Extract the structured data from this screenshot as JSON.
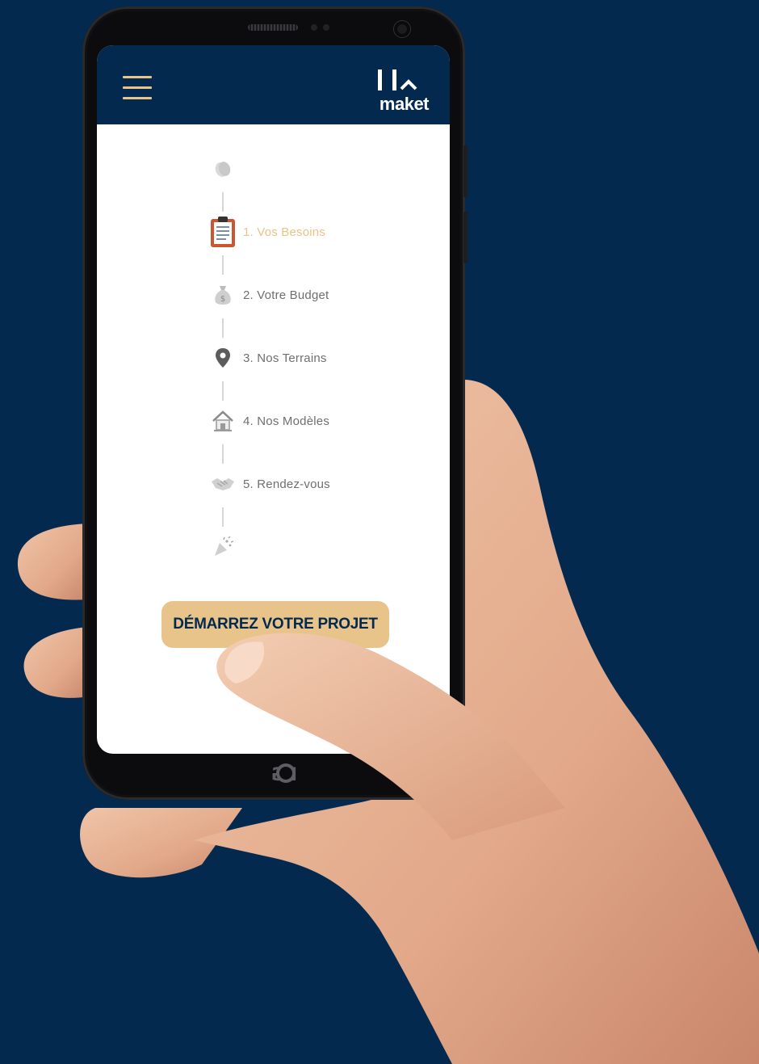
{
  "app": {
    "logo_text": "maket",
    "menu_icon": "hamburger-menu-icon"
  },
  "steps": [
    {
      "icon": "clap-hands-icon",
      "label": ""
    },
    {
      "icon": "clipboard-icon",
      "label": "1. Vos Besoins",
      "active": true
    },
    {
      "icon": "money-bag-icon",
      "label": "2. Votre Budget"
    },
    {
      "icon": "location-pin-icon",
      "label": "3. Nos Terrains"
    },
    {
      "icon": "house-icon",
      "label": "4. Nos Modèles"
    },
    {
      "icon": "handshake-icon",
      "label": "5. Rendez-vous"
    },
    {
      "icon": "party-popper-icon",
      "label": ""
    }
  ],
  "cta": {
    "label": "DÉMARREZ VOTRE PROJET"
  },
  "device": {
    "brand": "LG"
  },
  "colors": {
    "background": "#04294f",
    "accent": "#e9c48a",
    "step_text": "#6f6f6f"
  }
}
